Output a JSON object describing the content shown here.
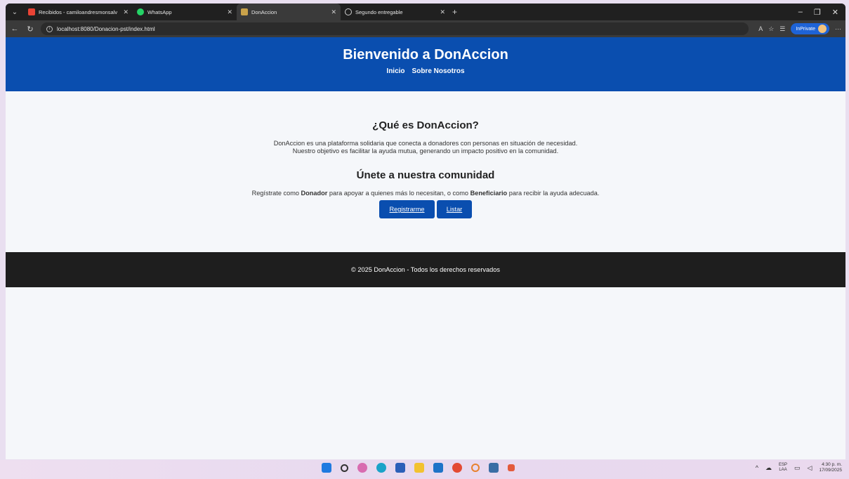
{
  "browser": {
    "tabs": [
      {
        "title": "Recibidos - camiloandresmonsalv",
        "active": false
      },
      {
        "title": "WhatsApp",
        "active": false
      },
      {
        "title": "DonAccion",
        "active": true
      },
      {
        "title": "Segundo entregable",
        "active": false
      }
    ],
    "new_tab": "+",
    "url": "localhost:8080/Donacion-pst/index.html",
    "inprivate_label": "InPrivate",
    "icons": {
      "menu": "chevron-down-icon",
      "close": "close-icon",
      "back": "back-arrow-icon",
      "reload": "reload-icon",
      "info": "info-icon",
      "read_aloud": "read-aloud-icon",
      "favorite": "star-icon",
      "favorites": "favorites-icon",
      "more": "more-icon"
    }
  },
  "site": {
    "title": "Bienvenido a DonAccion",
    "nav": [
      "Inicio",
      "Sobre Nosotros"
    ],
    "section1": {
      "heading": "¿Qué es DonAccion?",
      "line1": "DonAccion es una plataforma solidaria que conecta a donadores con personas en situación de necesidad.",
      "line2": "Nuestro objetivo es facilitar la ayuda mutua, generando un impacto positivo en la comunidad."
    },
    "section2": {
      "heading": "Únete a nuestra comunidad",
      "text_a": "Regístrate como ",
      "bold1": "Donador",
      "text_b": " para apoyar a quienes más lo necesitan, o como ",
      "bold2": "Beneficiario",
      "text_c": " para recibir la ayuda adecuada."
    },
    "buttons": {
      "register": "Registrarme",
      "list": "Listar"
    },
    "footer": "© 2025 DonAccion - Todos los derechos reservados",
    "colors": {
      "primary": "#0a4eaf",
      "footer": "#1e1e1e",
      "background": "#f5f7fa"
    }
  },
  "taskbar": {
    "lang_top": "ESP",
    "lang_bottom": "LAA",
    "time": "4:30 p. m.",
    "date": "17/09/2025"
  }
}
